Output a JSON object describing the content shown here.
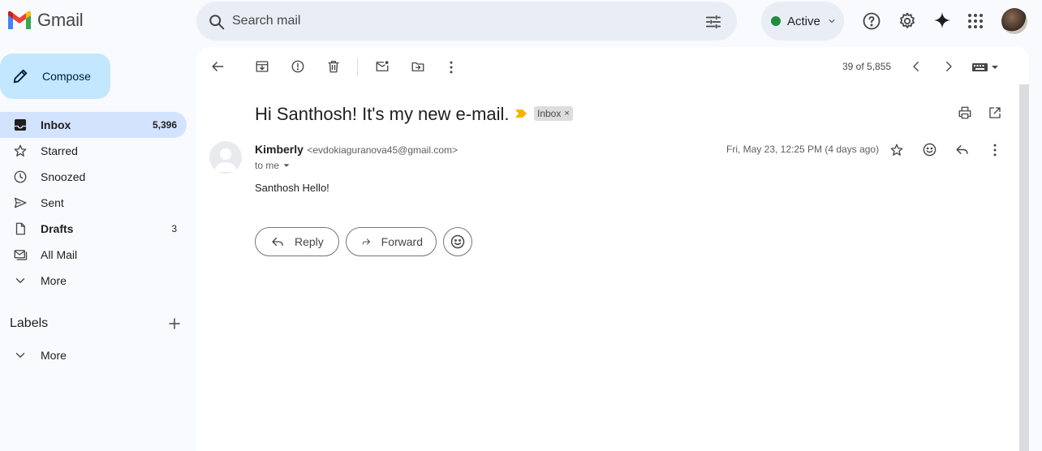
{
  "app": {
    "name": "Gmail"
  },
  "search": {
    "placeholder": "Search mail"
  },
  "status": {
    "label": "Active",
    "color": "#1e8e3e"
  },
  "compose": {
    "label": "Compose"
  },
  "sidebar": {
    "items": [
      {
        "label": "Inbox",
        "count": "5,396",
        "icon": "inbox-icon"
      },
      {
        "label": "Starred",
        "count": "",
        "icon": "star-icon"
      },
      {
        "label": "Snoozed",
        "count": "",
        "icon": "clock-icon"
      },
      {
        "label": "Sent",
        "count": "",
        "icon": "send-icon"
      },
      {
        "label": "Drafts",
        "count": "3",
        "icon": "draft-icon"
      },
      {
        "label": "All Mail",
        "count": "",
        "icon": "all-mail-icon"
      },
      {
        "label": "More",
        "count": "",
        "icon": "chevron-down-icon"
      }
    ],
    "labels_title": "Labels",
    "labels_more": "More"
  },
  "toolbar": {
    "pager": "39 of 5,855"
  },
  "email": {
    "subject": "Hi Santhosh! It's my new e-mail.",
    "label_chip": "Inbox",
    "label_chip_close": "×",
    "sender_name": "Kimberly",
    "sender_email": "<evdokiaguranova45@gmail.com>",
    "to": "to me",
    "date": "Fri, May 23, 12:25 PM (4 days ago)",
    "body": "Santhosh Hello!"
  },
  "actions": {
    "reply": "Reply",
    "forward": "Forward"
  },
  "colors": {
    "compose_bg": "#c2e7ff",
    "inbox_active_bg": "#d3e3fd",
    "search_bg": "#e9eef6",
    "important_marker": "#f4b400"
  }
}
